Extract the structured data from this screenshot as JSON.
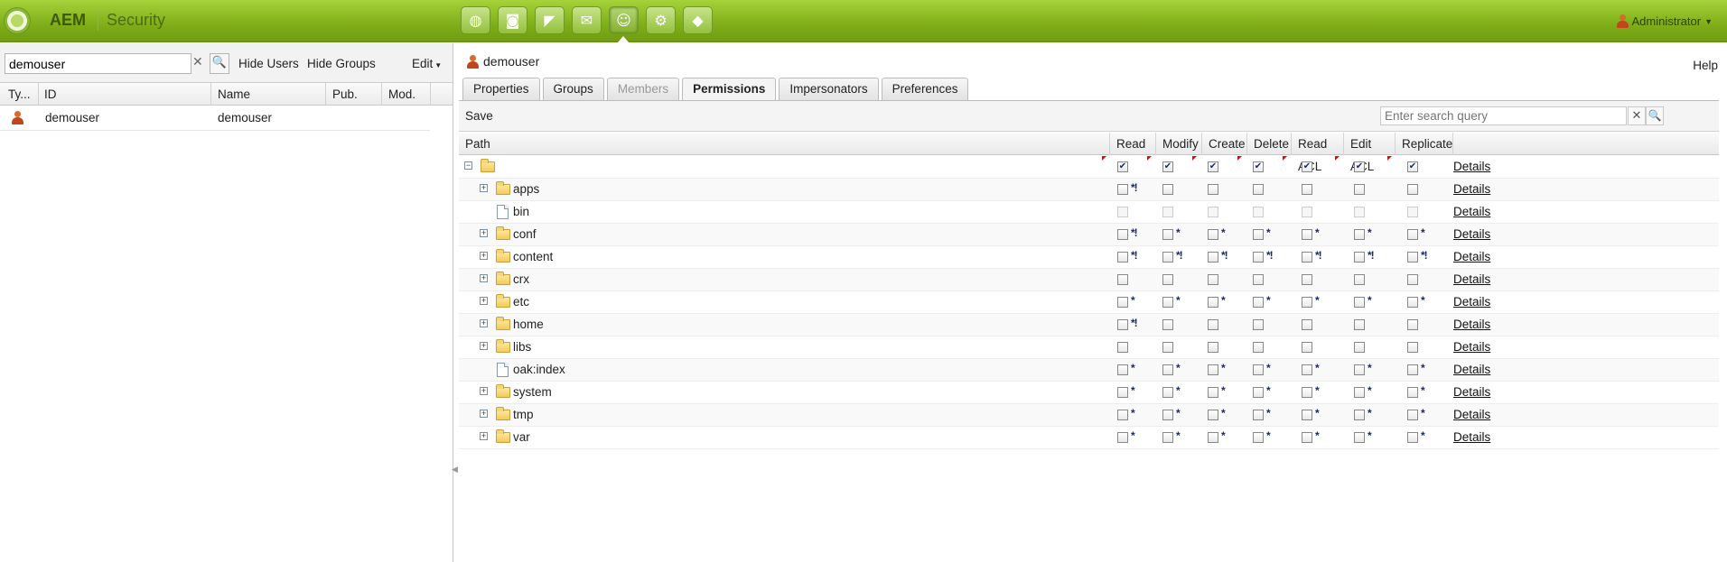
{
  "topbar": {
    "brand": "AEM",
    "title": "Security",
    "nav_icons": [
      "globe-icon",
      "camera-icon",
      "megaphone-icon",
      "mail-icon",
      "users-icon",
      "gear-icon",
      "tag-icon"
    ],
    "active_nav": 4,
    "user_menu": "Administrator"
  },
  "left": {
    "search_value": "demouser",
    "hide_users": "Hide Users",
    "hide_groups": "Hide Groups",
    "edit": "Edit",
    "columns": [
      "Ty...",
      "ID",
      "Name",
      "Pub.",
      "Mod."
    ],
    "rows": [
      {
        "id": "demouser",
        "name": "demouser",
        "pub": "",
        "mod": ""
      }
    ]
  },
  "right": {
    "user": "demouser",
    "help": "Help",
    "tabs": [
      {
        "label": "Properties",
        "state": "normal"
      },
      {
        "label": "Groups",
        "state": "normal"
      },
      {
        "label": "Members",
        "state": "disabled"
      },
      {
        "label": "Permissions",
        "state": "active"
      },
      {
        "label": "Impersonators",
        "state": "normal"
      },
      {
        "label": "Preferences",
        "state": "normal"
      }
    ],
    "save": "Save",
    "search_placeholder": "Enter search query",
    "columns": [
      "Path",
      "Read",
      "Modify",
      "Create",
      "Delete",
      "Read ACL",
      "Edit ACL",
      "Replicate"
    ],
    "details_label": "Details",
    "rows": [
      {
        "name": "",
        "type": "folder",
        "expander": "minus",
        "indent": 0,
        "perms": [
          "checked",
          "checked",
          "checked",
          "checked",
          "checked",
          "checked",
          "checked"
        ],
        "marks": [
          "",
          "",
          "",
          "",
          "",
          "",
          ""
        ],
        "dirty": true
      },
      {
        "name": "apps",
        "type": "folder",
        "expander": "plus",
        "indent": 1,
        "perms": [
          "unchecked",
          "unchecked",
          "unchecked",
          "unchecked",
          "unchecked",
          "unchecked",
          "unchecked"
        ],
        "marks": [
          "*!",
          "",
          "",
          "",
          "",
          "",
          ""
        ]
      },
      {
        "name": "bin",
        "type": "file",
        "expander": "",
        "indent": 1,
        "perms": [
          "disabled",
          "disabled",
          "disabled",
          "disabled",
          "disabled",
          "disabled",
          "disabled"
        ],
        "marks": [
          "",
          "",
          "",
          "",
          "",
          "",
          ""
        ]
      },
      {
        "name": "conf",
        "type": "folder",
        "expander": "plus",
        "indent": 1,
        "perms": [
          "unchecked",
          "unchecked",
          "unchecked",
          "unchecked",
          "unchecked",
          "unchecked",
          "unchecked"
        ],
        "marks": [
          "*!",
          "*",
          "*",
          "*",
          "*",
          "*",
          "*"
        ]
      },
      {
        "name": "content",
        "type": "folder",
        "expander": "plus",
        "indent": 1,
        "perms": [
          "unchecked",
          "unchecked",
          "unchecked",
          "unchecked",
          "unchecked",
          "unchecked",
          "unchecked"
        ],
        "marks": [
          "*!",
          "*!",
          "*!",
          "*!",
          "*!",
          "*!",
          "*!"
        ]
      },
      {
        "name": "crx",
        "type": "folder",
        "expander": "plus",
        "indent": 1,
        "perms": [
          "unchecked",
          "unchecked",
          "unchecked",
          "unchecked",
          "unchecked",
          "unchecked",
          "unchecked"
        ],
        "marks": [
          "",
          "",
          "",
          "",
          "",
          "",
          ""
        ]
      },
      {
        "name": "etc",
        "type": "folder",
        "expander": "plus",
        "indent": 1,
        "perms": [
          "unchecked",
          "unchecked",
          "unchecked",
          "unchecked",
          "unchecked",
          "unchecked",
          "unchecked"
        ],
        "marks": [
          "*",
          "*",
          "*",
          "*",
          "*",
          "*",
          "*"
        ]
      },
      {
        "name": "home",
        "type": "folder",
        "expander": "plus",
        "indent": 1,
        "perms": [
          "unchecked",
          "unchecked",
          "unchecked",
          "unchecked",
          "unchecked",
          "unchecked",
          "unchecked"
        ],
        "marks": [
          "*!",
          "",
          "",
          "",
          "",
          "",
          ""
        ]
      },
      {
        "name": "libs",
        "type": "folder",
        "expander": "plus",
        "indent": 1,
        "perms": [
          "unchecked",
          "unchecked",
          "unchecked",
          "unchecked",
          "unchecked",
          "unchecked",
          "unchecked"
        ],
        "marks": [
          "",
          "",
          "",
          "",
          "",
          "",
          ""
        ]
      },
      {
        "name": "oak:index",
        "type": "file",
        "expander": "",
        "indent": 1,
        "perms": [
          "unchecked",
          "unchecked",
          "unchecked",
          "unchecked",
          "unchecked",
          "unchecked",
          "unchecked"
        ],
        "marks": [
          "*",
          "*",
          "*",
          "*",
          "*",
          "*",
          "*"
        ]
      },
      {
        "name": "system",
        "type": "folder",
        "expander": "plus",
        "indent": 1,
        "perms": [
          "unchecked",
          "unchecked",
          "unchecked",
          "unchecked",
          "unchecked",
          "unchecked",
          "unchecked"
        ],
        "marks": [
          "*",
          "*",
          "*",
          "*",
          "*",
          "*",
          "*"
        ]
      },
      {
        "name": "tmp",
        "type": "folder",
        "expander": "plus",
        "indent": 1,
        "perms": [
          "unchecked",
          "unchecked",
          "unchecked",
          "unchecked",
          "unchecked",
          "unchecked",
          "unchecked"
        ],
        "marks": [
          "*",
          "*",
          "*",
          "*",
          "*",
          "*",
          "*"
        ]
      },
      {
        "name": "var",
        "type": "folder",
        "expander": "plus",
        "indent": 1,
        "perms": [
          "unchecked",
          "unchecked",
          "unchecked",
          "unchecked",
          "unchecked",
          "unchecked",
          "unchecked"
        ],
        "marks": [
          "*",
          "*",
          "*",
          "*",
          "*",
          "*",
          "*"
        ]
      }
    ]
  }
}
